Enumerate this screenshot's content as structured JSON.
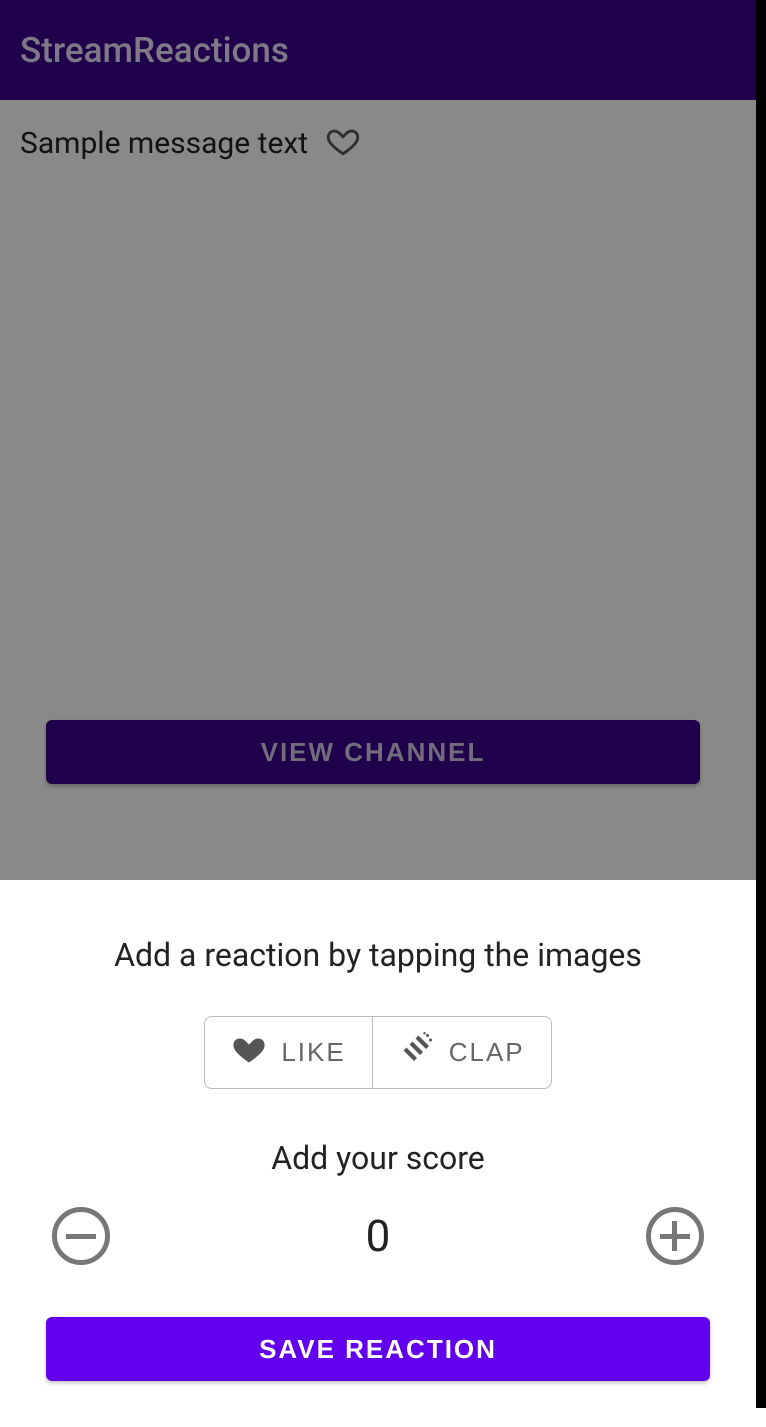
{
  "header": {
    "title": "StreamReactions"
  },
  "main": {
    "message_text": "Sample message text",
    "view_channel_label": "VIEW CHANNEL"
  },
  "sheet": {
    "instruction": "Add a reaction by tapping the images",
    "like_label": "LIKE",
    "clap_label": "CLAP",
    "score_label": "Add your score",
    "score_value": "0",
    "save_label": "SAVE REACTION"
  }
}
